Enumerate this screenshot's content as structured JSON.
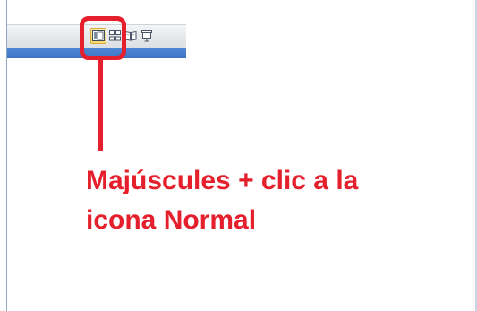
{
  "view_buttons": [
    {
      "icon": "normal-view-icon",
      "active": true
    },
    {
      "icon": "slide-sorter-view-icon",
      "active": false
    },
    {
      "icon": "reading-view-icon",
      "active": false
    },
    {
      "icon": "slide-show-icon",
      "active": false
    }
  ],
  "annotation": {
    "line1": "Majúscules + clic a la",
    "line2": "icona Normal",
    "color": "#e51f2b"
  },
  "colors": {
    "highlight": "#e51f2b",
    "blue_bar": "#3b74c4",
    "active_button": "#f7d96a"
  }
}
